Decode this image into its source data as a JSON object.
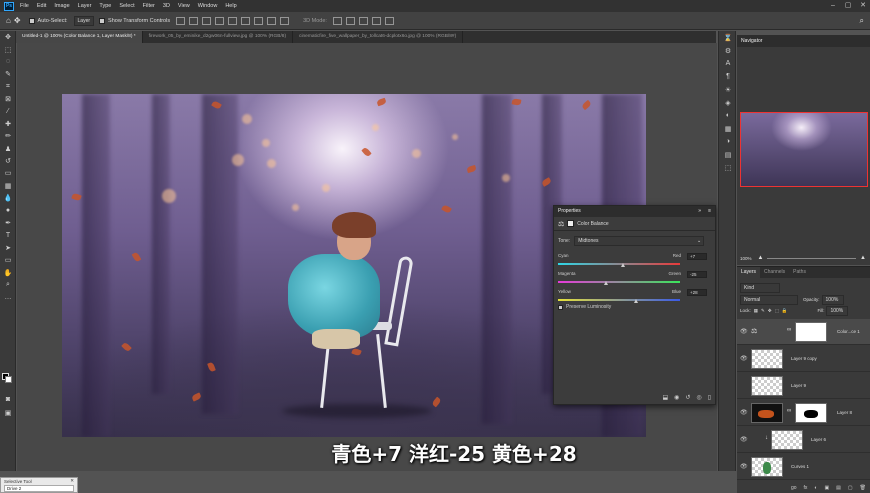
{
  "menubar": {
    "logo": "Ps",
    "items": [
      "File",
      "Edit",
      "Image",
      "Layer",
      "Type",
      "Select",
      "Filter",
      "3D",
      "View",
      "Window",
      "Help"
    ],
    "controls": [
      "–",
      "▢",
      "✕"
    ]
  },
  "options": {
    "auto_select": "Auto-Select:",
    "auto_select_target": "Layer",
    "show_transform": "Show Transform Controls",
    "mode_3d": "3D Mode:"
  },
  "tabs": [
    "Untitled-1 @ 100% (Color Balance 1, Layer Mask/8) *",
    "firework_05_by_eminike_d2gw06n-fullview.jpg @ 100% (RGB/8)",
    "cinematicfire_five_wallpaper_by_tollcat6-dcplotx6o.jpg @ 100% (RGB/8#)"
  ],
  "properties": {
    "title": "Properties",
    "adjustment": "Color Balance",
    "tone_label": "Tone:",
    "tone_value": "Midtones",
    "sliders": [
      {
        "left": "Cyan",
        "right": "Red",
        "value": "+7",
        "pos": 0.535,
        "colors": [
          "#2fd6e6",
          "#e83a3a"
        ]
      },
      {
        "left": "Magenta",
        "right": "Green",
        "value": "-25",
        "pos": 0.395,
        "colors": [
          "#e63ad9",
          "#3ae65a"
        ]
      },
      {
        "left": "Yellow",
        "right": "Blue",
        "value": "+28",
        "pos": 0.64,
        "colors": [
          "#e6e23a",
          "#3a5ae6"
        ]
      }
    ],
    "preserve": "Preserve Luminosity"
  },
  "caption": "青色+7 洋红-25 黄色+28",
  "navigator": {
    "title": "Navigator",
    "zoom": "100%"
  },
  "layers": {
    "tabs": [
      "Layers",
      "Channels",
      "Paths"
    ],
    "kind": "Kind",
    "blend_mode": "Normal",
    "opacity_label": "Opacity:",
    "opacity": "100%",
    "lock_label": "Lock:",
    "fill_label": "Fill:",
    "fill": "100%",
    "rows": [
      {
        "name": "Color...ce 1",
        "type": "adjustment"
      },
      {
        "name": "Layer 9 copy",
        "type": "pixel"
      },
      {
        "name": "Layer 9",
        "type": "pixel"
      },
      {
        "name": "Layer 8",
        "type": "masked"
      },
      {
        "name": "Layer 6",
        "type": "pixel"
      },
      {
        "name": "Curves 1",
        "type": "pixel"
      }
    ],
    "footer_icons": [
      "go",
      "fx",
      "◐",
      "▣",
      "▤",
      "▢",
      "🗑"
    ]
  },
  "miniwin": {
    "title": "Selective Tool",
    "value": "Drive 2"
  }
}
